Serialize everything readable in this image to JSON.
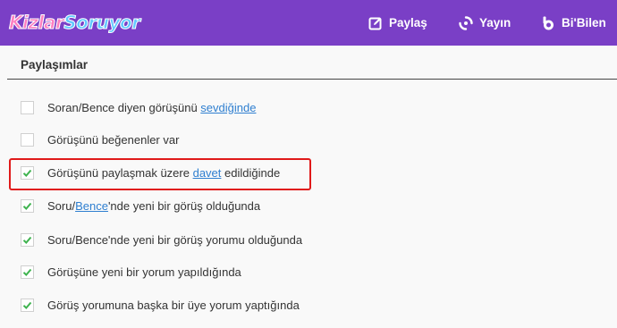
{
  "header": {
    "logo": {
      "part1": "Kizlar",
      "part2": "Soruyor"
    },
    "nav": [
      {
        "label": "Paylaş",
        "icon": "edit-icon"
      },
      {
        "label": "Yayın",
        "icon": "broadcast-icon"
      },
      {
        "label": "Bi'Bilen",
        "icon": "bibilen-icon"
      }
    ]
  },
  "section": {
    "title": "Paylaşımlar"
  },
  "options": [
    {
      "checked": false,
      "pre": "Soran/Bence diyen görüşünü ",
      "link": "sevdiğinde",
      "post": ""
    },
    {
      "checked": false,
      "pre": "Görüşünü beğenenler var",
      "link": "",
      "post": ""
    },
    {
      "checked": true,
      "pre": "Görüşünü paylaşmak üzere ",
      "link": "davet",
      "post": " edildiğinde",
      "highlighted": true
    },
    {
      "checked": true,
      "pre": "Soru/",
      "link": "Bence",
      "post": "'nde yeni bir görüş olduğunda"
    },
    {
      "checked": true,
      "pre": "Soru/Bence'nde yeni bir görüş yorumu olduğunda",
      "link": "",
      "post": ""
    },
    {
      "checked": true,
      "pre": "Görüşüne yeni bir yorum yapıldığında",
      "link": "",
      "post": ""
    },
    {
      "checked": true,
      "pre": "Görüş yorumuna başka bir üye yorum yaptığında",
      "link": "",
      "post": ""
    }
  ],
  "colors": {
    "header": "#7a3fc6",
    "check": "#3fb34f",
    "link": "#2f7fd0",
    "highlight": "#e01a1a"
  }
}
